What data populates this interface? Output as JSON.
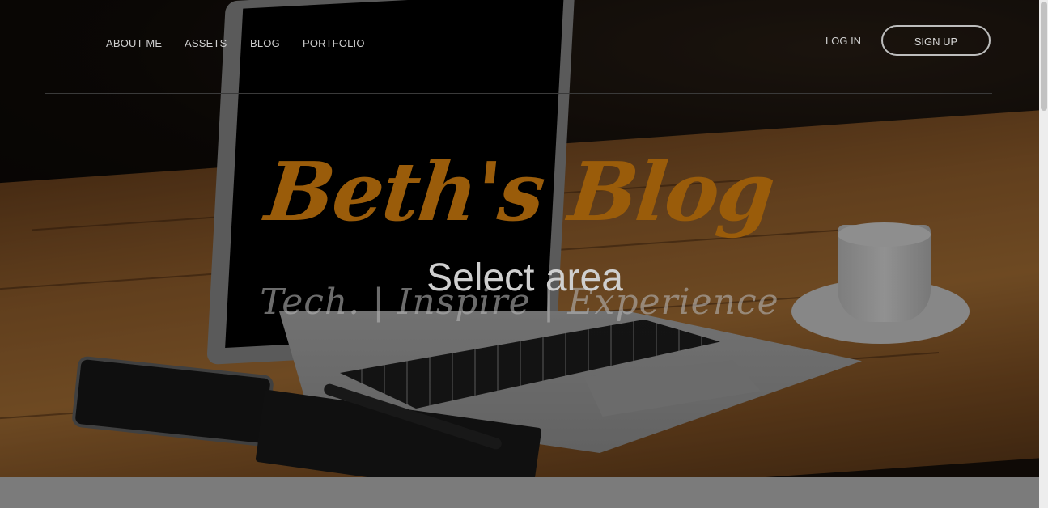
{
  "nav": {
    "links": [
      "ABOUT ME",
      "ASSETS",
      "BLOG",
      "PORTFOLIO"
    ],
    "login_label": "LOG IN",
    "signup_label": "SIGN UP"
  },
  "hero": {
    "title": "Beth's Blog",
    "tagline": "Tech. | Inspire | Experience"
  },
  "overlay": {
    "label": "Select area"
  },
  "colors": {
    "title": "#9a5c0a",
    "nav_text": "#cfcfcf"
  }
}
